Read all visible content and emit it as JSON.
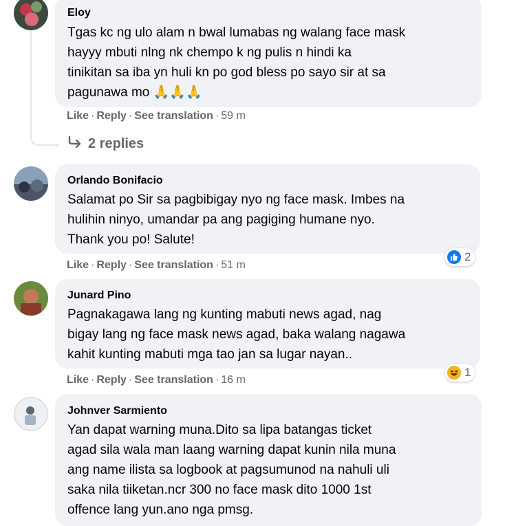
{
  "comments": [
    {
      "author": "Eloy",
      "lines": [
        "Tgas kc ng ulo alam n bwal lumabas ng walang face mask",
        "hayyy mbuti nlng nk chempo k ng pulis n hindi ka",
        "tinikitan sa iba yn huli kn po god bless po sayo sir at sa",
        "pagunawa mo"
      ],
      "emoji": "🙏🙏🙏",
      "like": "Like",
      "reply": "Reply",
      "translate": "See translation",
      "time": "59 m",
      "replies": "2 replies"
    },
    {
      "author": "Orlando Bonifacio",
      "lines": [
        "Salamat po Sir sa pagbibigay nyo ng face mask. Imbes na",
        "hulihin ninyo, umandar pa ang pagiging humane nyo.",
        "Thank you po! Salute!"
      ],
      "like": "Like",
      "reply": "Reply",
      "translate": "See translation",
      "time": "51 m",
      "reaction_count": "2"
    },
    {
      "author": "Junard Pino",
      "lines": [
        "Pagnakagawa lang ng kunting mabuti news agad, nag",
        "bigay lang ng face mask news agad, baka walang nagawa",
        "kahit kunting mabuti mga tao jan sa lugar nayan.."
      ],
      "like": "Like",
      "reply": "Reply",
      "translate": "See translation",
      "time": "16 m",
      "reaction_count": "1"
    },
    {
      "author": "Johnver Sarmiento",
      "lines": [
        "Yan dapat warning muna.Dito sa lipa batangas ticket",
        "agad sila wala man laang warning dapat kunin nila muna",
        "ang name ilista sa logbook at pagsumunod na nahuli uli",
        "saka nila tiiketan.ncr 300 no face mask dito 1000 1st",
        "offence lang yun.ano nga pmsg."
      ]
    }
  ],
  "colors": {
    "bubble": "#f0f2f5",
    "secondary_text": "#65676b",
    "like_blue": "#1877f2",
    "haha_yellow": "#f7b125"
  }
}
